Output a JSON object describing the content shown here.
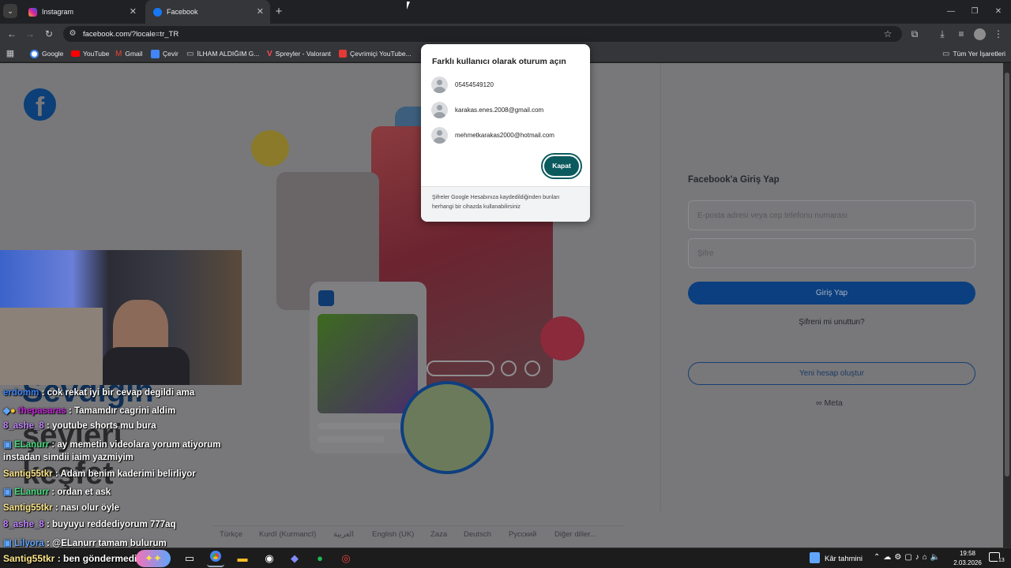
{
  "tabs": [
    {
      "title": "Instagram",
      "favicon_color": "#d6249f"
    },
    {
      "title": "Facebook",
      "favicon_color": "#1877f2"
    }
  ],
  "window_controls": {
    "minimize": "—",
    "restore": "❐",
    "close": "✕"
  },
  "address_bar": {
    "url": "facebook.com/?locale=tr_TR"
  },
  "bookmarks": [
    {
      "label": "Google",
      "icon": "google-icon"
    },
    {
      "label": "YouTube",
      "icon": "youtube-icon"
    },
    {
      "label": "Gmail",
      "icon": "gmail-icon"
    },
    {
      "label": "Çevir",
      "icon": "translate-icon"
    },
    {
      "label": "İLHAM ALDIĞIM G...",
      "icon": "folder-icon"
    },
    {
      "label": "Spreyler - Valorant",
      "icon": "valorant-icon"
    },
    {
      "label": "Çevrimiçi YouTube...",
      "icon": "youtube-converter-icon"
    }
  ],
  "all_bookmarks": "Tüm Yer İşaretleri",
  "password_popup": {
    "title": "Farklı kullanıcı olarak oturum açın",
    "accounts": [
      "05454549120",
      "karakas.enes.2008@gmail.com",
      "mehmetkarakas2000@hotmail.com"
    ],
    "close_label": "Kapat",
    "footer": "Şifreler Google Hesabınıza kaydedildiğinden bunları herhangi bir cihazda kullanabilirsiniz"
  },
  "facebook": {
    "login_title": "Facebook'a Giriş Yap",
    "email_placeholder": "E-posta adresi veya cep telefonu numarası",
    "password_placeholder": "Şifre",
    "login_button": "Giriş Yap",
    "forgot_password": "Şifreni mi unuttun?",
    "create_account": "Yeni hesap oluştur",
    "meta_label": "Meta",
    "brand_color": "#1877f2"
  },
  "languages": [
    "Türkçe",
    "Kurdî (Kurmancî)",
    "العربية",
    "English (UK)",
    "Zaza",
    "Deutsch",
    "Русский",
    "Diğer diller..."
  ],
  "overlay_text": [
    "Sevdiğin",
    "şeyleri",
    "keşfet"
  ],
  "chat": [
    {
      "user": "erdomm",
      "msg": ": cok rekat iyi bir cevap degildi ama",
      "color": "#3b82f6"
    },
    {
      "user": "thepasaras",
      "msg": ": Tamamdır cagrini aldim",
      "color": "#c026d3"
    },
    {
      "user": "8_ashe_8",
      "msg": ": youtube shorts mu bura",
      "color": "#c084fc"
    },
    {
      "user": "ELanurr",
      "msg": ": ay memetin videolara yorum atiyorum",
      "color": "#4ade80"
    },
    {
      "user": "",
      "msg": "instadan simdii iaim yazmiyim",
      "color": "#ffffff"
    },
    {
      "user": "Santig55tkr",
      "msg": ": Adam benim kaderimi belirliyor",
      "color": "#fde68a"
    },
    {
      "user": "ELanurr",
      "msg": ": ordan et ask",
      "color": "#4ade80"
    },
    {
      "user": "Santig55tkr",
      "msg": ": nası olur öyle",
      "color": "#fde68a"
    },
    {
      "user": "8_ashe_8",
      "msg": ": buyuyu reddediyorum 777aq",
      "color": "#c084fc"
    },
    {
      "user": "Lilyora",
      "msg": ": @ELanurr tamam bulurum",
      "color": "#60a5fa"
    },
    {
      "user": "Santig55tkr",
      "msg": ": ben göndermedim",
      "color": "#fde68a"
    }
  ],
  "taskbar": {
    "weather": "Kâr tahmini",
    "time": "19:58",
    "date": "2.03.2026",
    "notification_count": "13"
  }
}
